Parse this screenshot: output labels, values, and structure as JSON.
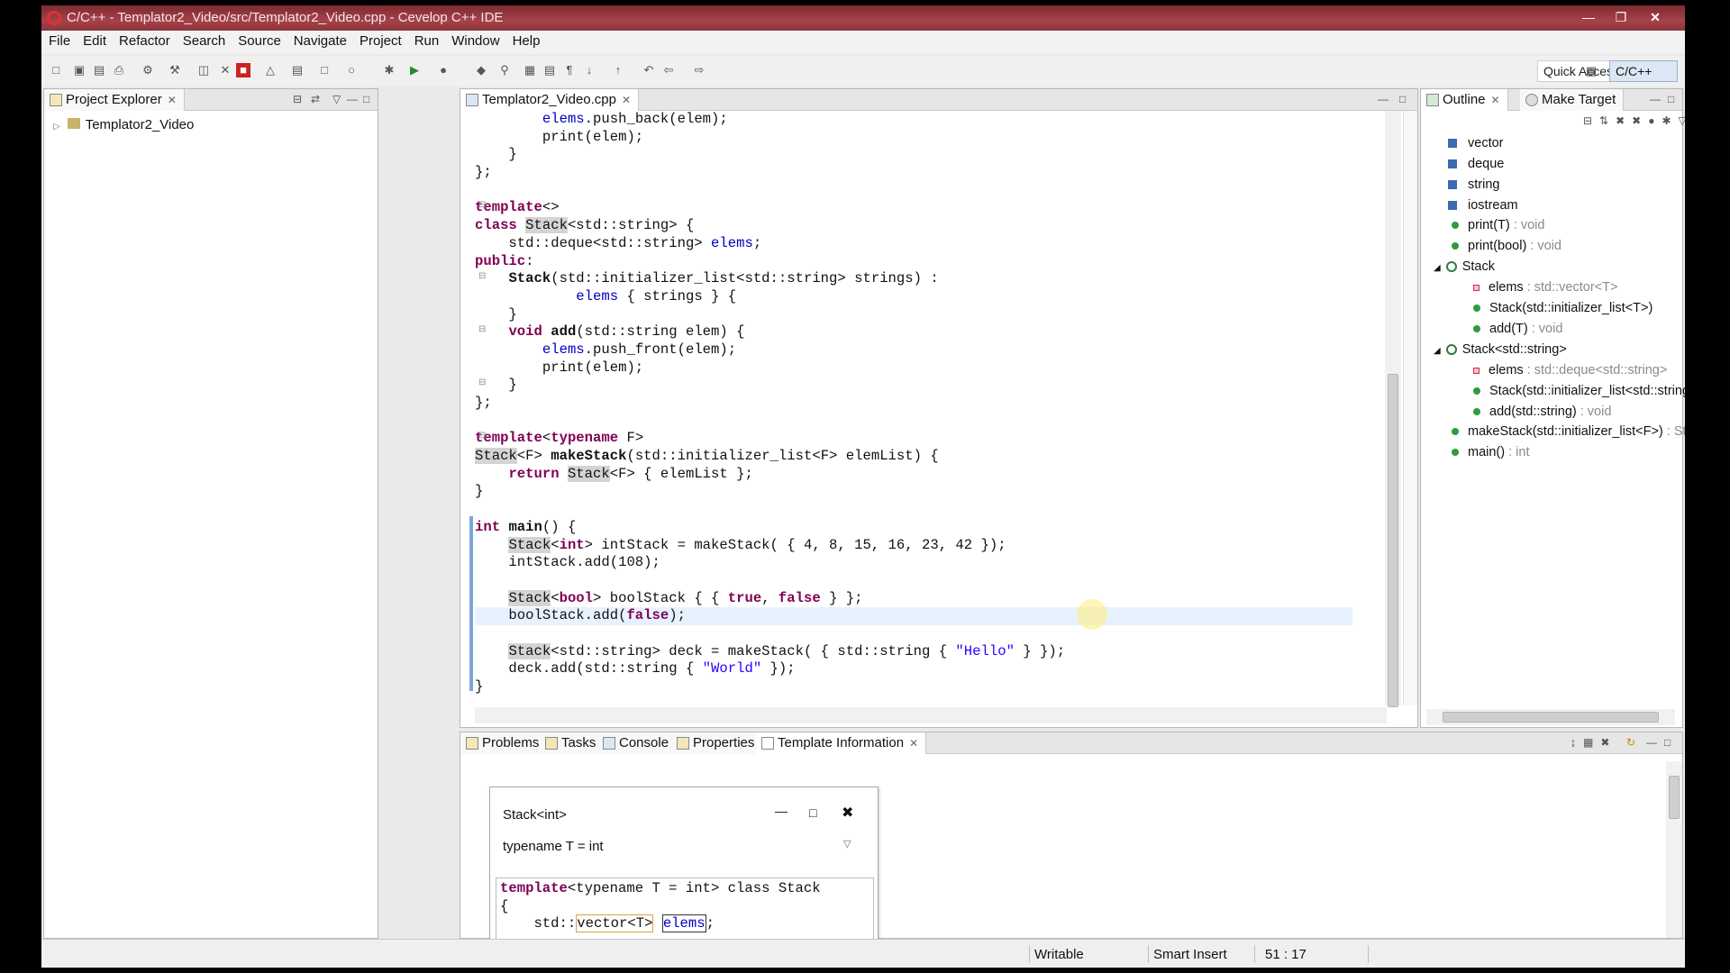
{
  "window": {
    "title": "C/C++ - Templator2_Video/src/Templator2_Video.cpp - Cevelop C++ IDE"
  },
  "menu": [
    "File",
    "Edit",
    "Refactor",
    "Search",
    "Source",
    "Navigate",
    "Project",
    "Run",
    "Window",
    "Help"
  ],
  "toolbar": {
    "quick_access": "Quick Access",
    "perspective": "C/C++"
  },
  "project_explorer": {
    "tab": "Project Explorer",
    "project": "Templator2_Video"
  },
  "editor": {
    "tab": "Templator2_Video.cpp"
  },
  "outline": {
    "tab": "Outline",
    "tab2": "Make Target",
    "items": [
      {
        "kind": "include",
        "label": "vector",
        "type": ""
      },
      {
        "kind": "include",
        "label": "deque",
        "type": ""
      },
      {
        "kind": "include",
        "label": "string",
        "type": ""
      },
      {
        "kind": "include",
        "label": "iostream",
        "type": ""
      },
      {
        "kind": "func",
        "label": "print(T)",
        "type": " : void"
      },
      {
        "kind": "func",
        "label": "print(bool)",
        "type": " : void"
      },
      {
        "kind": "class",
        "label": "Stack",
        "type": ""
      },
      {
        "kind": "field",
        "label": "elems",
        "type": " : std::vector<T>"
      },
      {
        "kind": "func",
        "label": "Stack(std::initializer_list<T>)",
        "type": ""
      },
      {
        "kind": "func",
        "label": "add(T)",
        "type": " : void"
      },
      {
        "kind": "class",
        "label": "Stack<std::string>",
        "type": ""
      },
      {
        "kind": "field",
        "label": "elems",
        "type": " : std::deque<std::string>"
      },
      {
        "kind": "func",
        "label": "Stack(std::initializer_list<std::string>)",
        "type": ""
      },
      {
        "kind": "func",
        "label": "add(std::string)",
        "type": " : void"
      },
      {
        "kind": "func",
        "label": "makeStack(std::initializer_list<F>)",
        "type": " : Stack<F"
      },
      {
        "kind": "func",
        "label": "main()",
        "type": " : int"
      }
    ]
  },
  "bottom_tabs": [
    "Problems",
    "Tasks",
    "Console",
    "Properties",
    "Template Information"
  ],
  "template_info": {
    "title": "Stack<int>",
    "subtitle": "typename T = int",
    "code_line1_kw": "template",
    "code_line1_rest": "<typename T = int> class Stack",
    "code_line2": "{",
    "code_line3_a": "std::",
    "code_line3_b": "vector<T>",
    "code_line3_c": "elems",
    "code_line3_d": ";"
  },
  "status": {
    "mode": "Writable",
    "insert": "Smart Insert",
    "position": "51 : 17"
  },
  "colors": {
    "keyword": "#7f0055",
    "field": "#0000c0",
    "string": "#2a00ff",
    "titlebar": "#a8414a"
  }
}
